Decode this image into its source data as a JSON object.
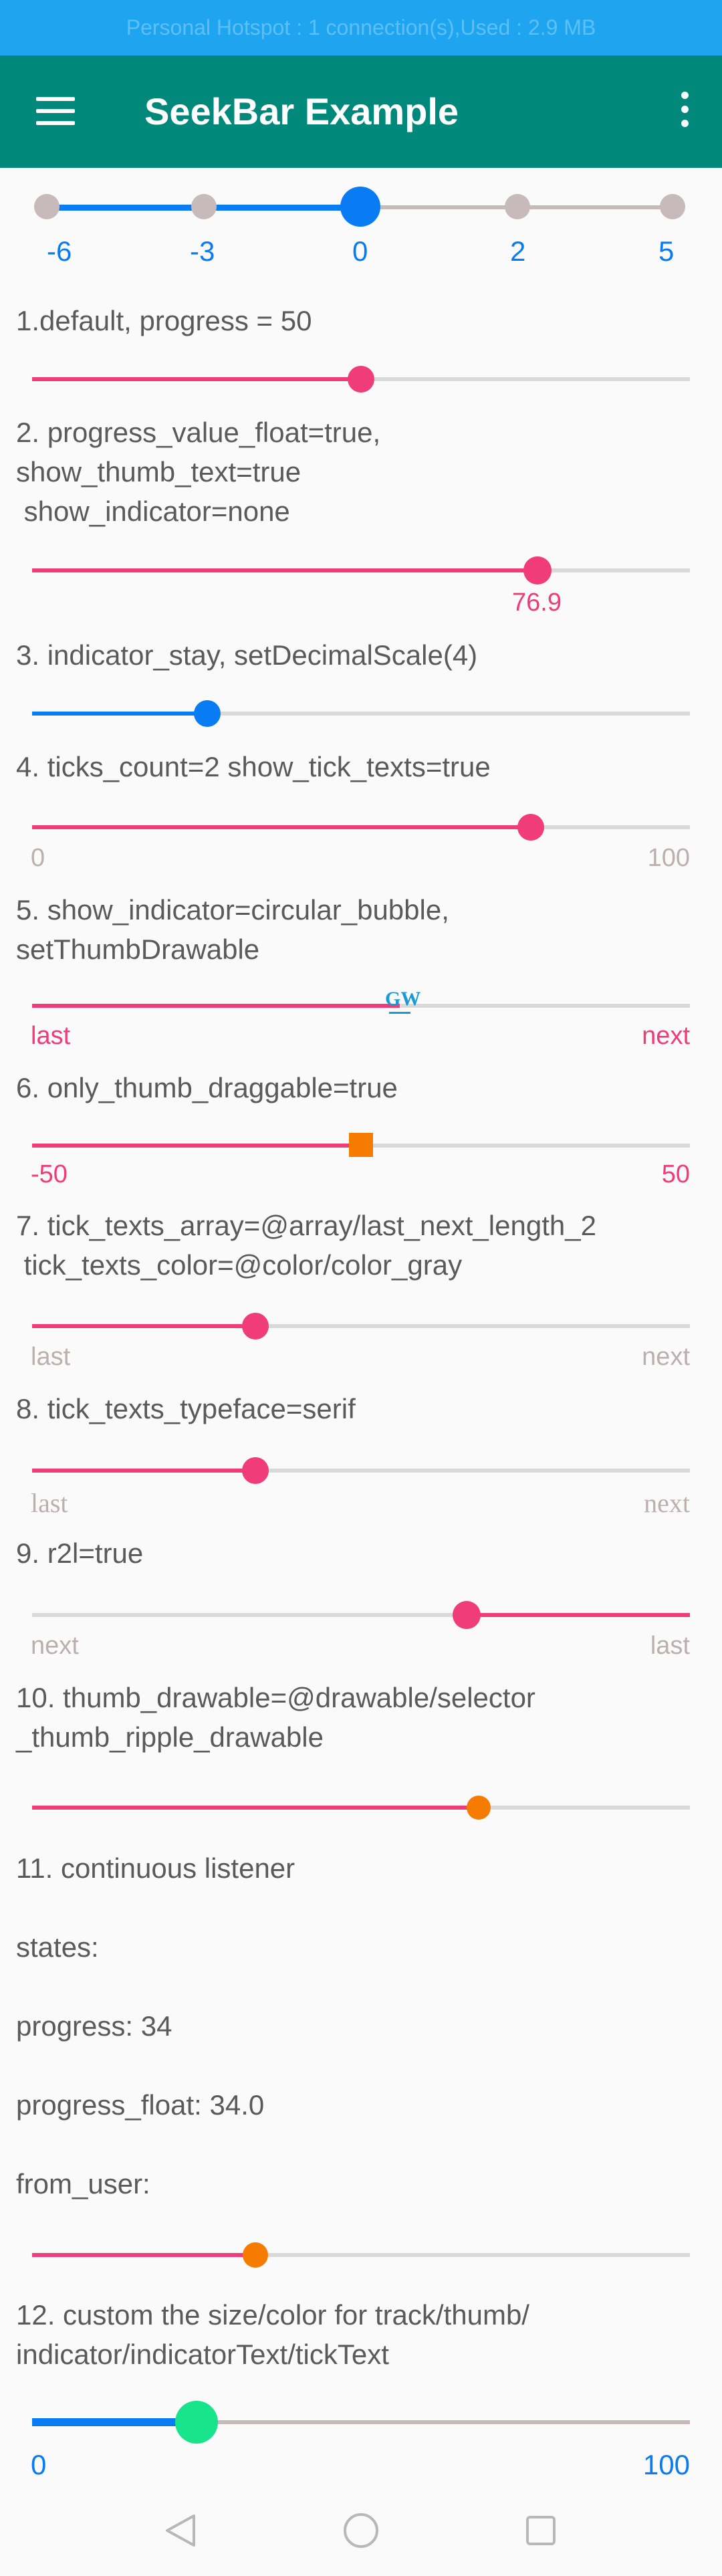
{
  "status_bar": {
    "text": "Personal Hotspot : 1 connection(s),Used : 2.9 MB"
  },
  "app_bar": {
    "title": "SeekBar Example"
  },
  "top_seekbar": {
    "tick_labels": [
      "-6",
      "-3",
      "0",
      "2",
      "5"
    ],
    "value": "0",
    "track_color": "#0a7cf3",
    "inactive_color": "#c6bbba"
  },
  "items": [
    {
      "heading": "1.default, progress = 50",
      "progress": 50
    },
    {
      "heading": "2. progress_value_float=true,\nshow_thumb_text=true\n show_indicator=none",
      "progress": 76.9,
      "thumb_text": "76.9"
    },
    {
      "heading": "3. indicator_stay, setDecimalScale(4)",
      "progress": 26.5
    },
    {
      "heading": "4. ticks_count=2 show_tick_texts=true",
      "progress": 76,
      "tick_left": "0",
      "tick_right": "100"
    },
    {
      "heading": "5. show_indicator=circular_bubble,\nsetThumbDrawable",
      "progress": 56,
      "tick_left": "last",
      "tick_right": "next",
      "thumb_logo": "GW"
    },
    {
      "heading": "6. only_thumb_draggable=true",
      "progress": 50,
      "tick_left": "-50",
      "tick_right": "50"
    },
    {
      "heading": "7. tick_texts_array=@array/last_next_length_2\n tick_texts_color=@color/color_gray",
      "progress": 34,
      "tick_left": "last",
      "tick_right": "next"
    },
    {
      "heading": "8. tick_texts_typeface=serif",
      "progress": 34,
      "tick_left": "last",
      "tick_right": "next"
    },
    {
      "heading": "9. r2l=true",
      "progress": 34,
      "tick_left": "next",
      "tick_right": "last"
    },
    {
      "heading": "10. thumb_drawable=@drawable/selector\n_thumb_ripple_drawable",
      "progress": 68
    },
    {
      "heading": "11. continuous listener",
      "progress": 34
    },
    {
      "heading": "12. custom the size/color for track/thumb/\nindicator/indicatorText/tickText",
      "progress": 25,
      "tick_left": "0",
      "tick_right": "100"
    }
  ],
  "listener": {
    "states": "states:",
    "progress": "progress: 34",
    "progress_float": "progress_float: 34.0",
    "from_user": "from_user:"
  },
  "colors": {
    "pink": "#f03c78",
    "blue": "#0a7cf3",
    "gray_track": "#d9d9d9",
    "orange": "#f57c00",
    "teal": "#00897b",
    "green_thumb": "#18e48b",
    "gray_text": "#bcb0ae"
  },
  "nav_icons": [
    "back-icon",
    "home-icon",
    "recents-icon"
  ]
}
